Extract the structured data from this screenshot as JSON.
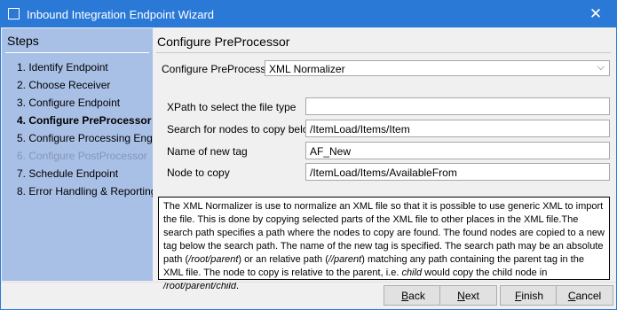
{
  "window": {
    "title": "Inbound Integration Endpoint Wizard",
    "close_glyph": "✕"
  },
  "steps": {
    "title": "Steps",
    "items": [
      {
        "label": "1. Identify Endpoint",
        "state": "normal"
      },
      {
        "label": "2. Choose Receiver",
        "state": "normal"
      },
      {
        "label": "3. Configure Endpoint",
        "state": "normal"
      },
      {
        "label": "4. Configure PreProcessor",
        "state": "active"
      },
      {
        "label": "5. Configure Processing Engine",
        "state": "normal"
      },
      {
        "label": "6. Configure PostProcessor",
        "state": "disabled"
      },
      {
        "label": "7. Schedule Endpoint",
        "state": "normal"
      },
      {
        "label": "8. Error Handling & Reporting",
        "state": "normal"
      }
    ]
  },
  "content": {
    "title": "Configure PreProcessor",
    "preprocessor": {
      "label": "Configure PreProcessor",
      "value": "XML Normalizer"
    },
    "fields": {
      "xpath": {
        "label": "XPath to select the file type",
        "value": ""
      },
      "search": {
        "label": "Search for nodes to copy below",
        "value": "/ItemLoad/Items/Item"
      },
      "newtag": {
        "label": "Name of new tag",
        "value": "AF_New"
      },
      "node": {
        "label": "Node to copy",
        "value": "/ItemLoad/Items/AvailableFrom"
      }
    },
    "description": {
      "p1": "The XML Normalizer is use to normalize an XML file so that it is possible to use generic XML to import the file. This is done by copying selected parts of the XML file to other places in the XML file.The search path specifies a path where the nodes to copy are found. The found nodes are copied to a new tag below the search path. The name of the new tag is specified. The search path may be an absolute path (",
      "e1": "/root/parent",
      "p2": ") or an relative path (",
      "e2": "//parent",
      "p3": ") matching any path containing the parent tag in the XML file. The node to copy is relative to the parent, i.e. ",
      "e3": "child",
      "p4": " would copy the child node in ",
      "e4": "/root/parent/child",
      "p5": "."
    }
  },
  "footer": {
    "back": {
      "mnemonic": "B",
      "rest": "ack"
    },
    "next": {
      "mnemonic": "N",
      "rest": "ext"
    },
    "finish": {
      "mnemonic": "F",
      "rest": "inish"
    },
    "cancel": {
      "mnemonic": "C",
      "rest": "ancel"
    }
  }
}
